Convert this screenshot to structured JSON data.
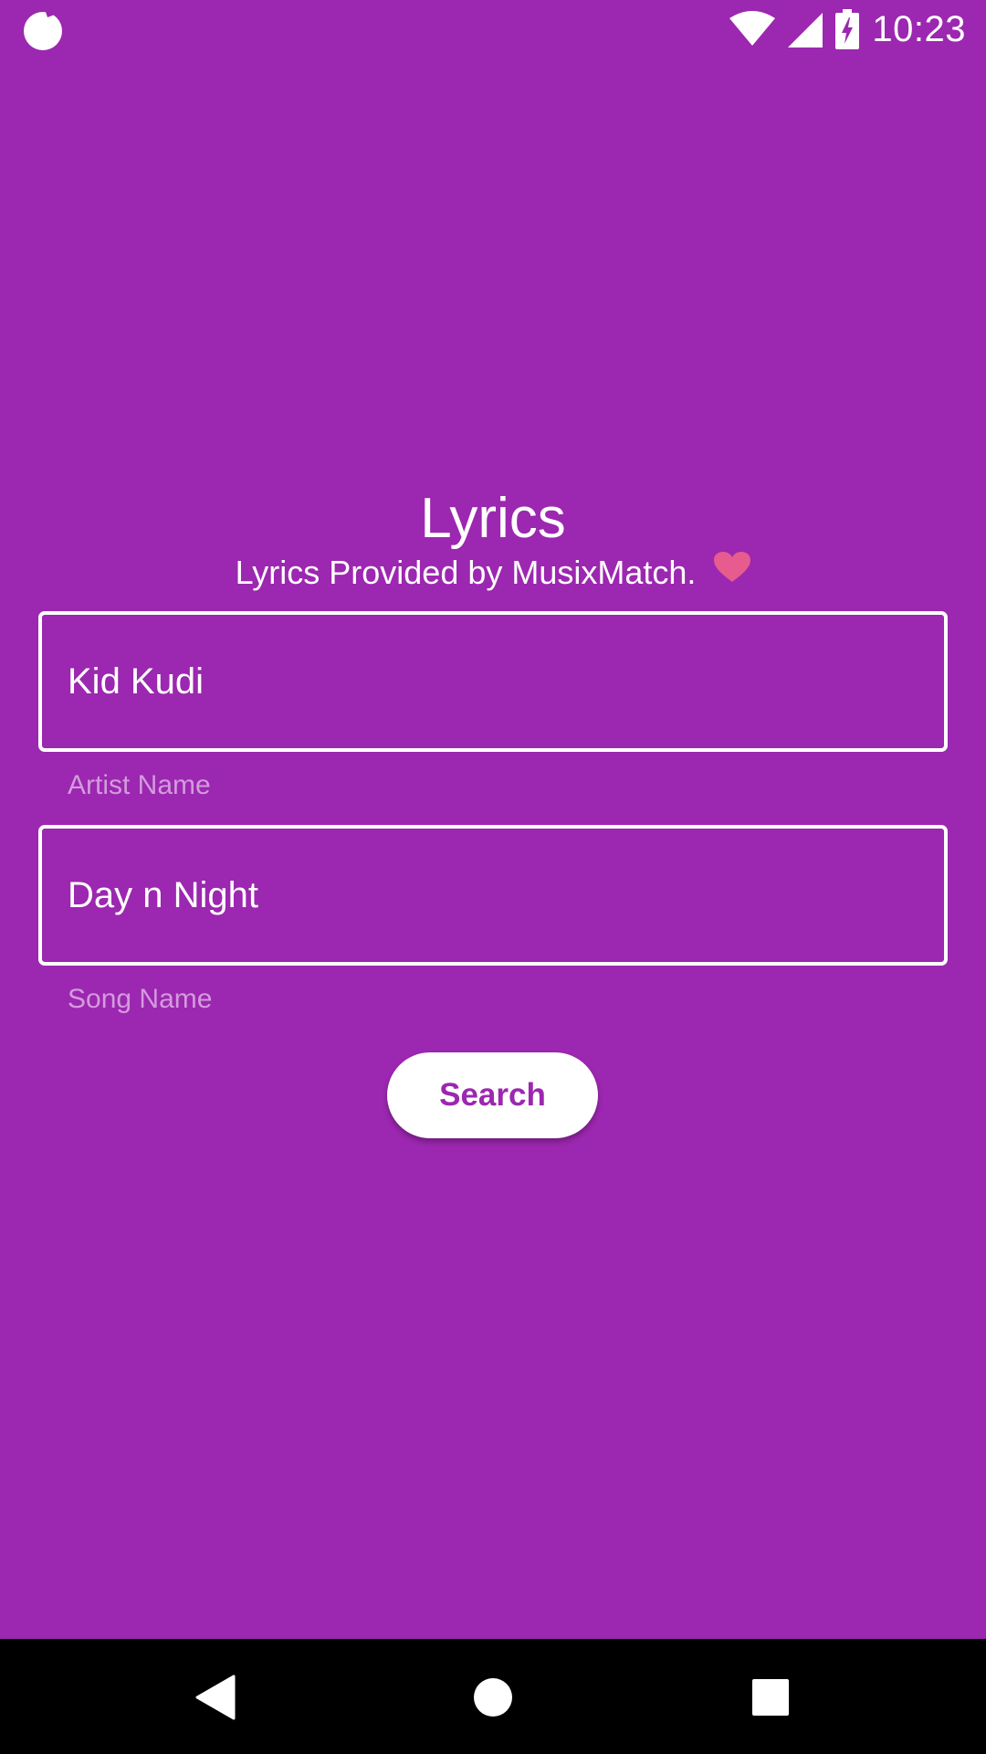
{
  "status_bar": {
    "time": "10:23",
    "left_icon": "notification-circle-icon",
    "wifi_icon": "wifi-icon",
    "signal_icon": "cell-signal-icon",
    "battery_icon": "battery-charging-icon"
  },
  "header": {
    "title": "Lyrics",
    "subtitle": "Lyrics Provided by MusixMatch.",
    "heart_icon": "heart-icon",
    "heart_color": "#E65C8E"
  },
  "form": {
    "artist": {
      "value": "Kid Kudi",
      "label": "Artist Name"
    },
    "song": {
      "value": "Day n Night",
      "label": "Song Name"
    },
    "search_label": "Search"
  },
  "colors": {
    "background": "#9C27B0",
    "helper_text": "#D39BDD",
    "button_bg": "#FFFFFF",
    "button_text": "#9C27B0"
  },
  "nav_bar": {
    "back_icon": "back-triangle-icon",
    "home_icon": "home-circle-icon",
    "recents_icon": "recents-square-icon"
  }
}
